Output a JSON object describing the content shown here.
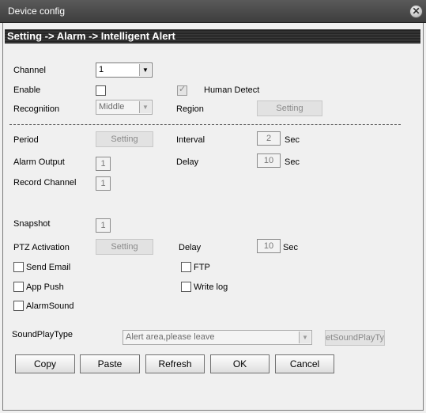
{
  "window": {
    "title": "Device config"
  },
  "breadcrumb": "Setting -> Alarm -> Intelligent Alert",
  "fields": {
    "channel": {
      "label": "Channel",
      "value": "1"
    },
    "enable": {
      "label": "Enable",
      "checked": false
    },
    "human_detect": {
      "label": "Human Detect",
      "checked": true
    },
    "recognition": {
      "label": "Recognition",
      "value": "Middle"
    },
    "region": {
      "label": "Region",
      "button": "Setting"
    },
    "period": {
      "label": "Period",
      "button": "Setting"
    },
    "interval": {
      "label": "Interval",
      "value": "2",
      "unit": "Sec"
    },
    "alarm_output": {
      "label": "Alarm Output",
      "value": "1"
    },
    "delay1": {
      "label": "Delay",
      "value": "10",
      "unit": "Sec"
    },
    "record_channel": {
      "label": "Record Channel",
      "value": "1"
    },
    "snapshot": {
      "label": "Snapshot",
      "value": "1"
    },
    "ptz_activation": {
      "label": "PTZ Activation",
      "button": "Setting"
    },
    "delay2": {
      "label": "Delay",
      "value": "10",
      "unit": "Sec"
    },
    "send_email": {
      "label": "Send Email",
      "checked": false
    },
    "ftp": {
      "label": "FTP",
      "checked": false
    },
    "app_push": {
      "label": "App Push",
      "checked": false
    },
    "write_log": {
      "label": "Write log",
      "checked": false
    },
    "alarm_sound": {
      "label": "AlarmSound",
      "checked": false
    },
    "sound_play_type": {
      "label": "SoundPlayType",
      "value": "Alert area,please leave",
      "button": "etSoundPlayTyp"
    }
  },
  "buttons": {
    "copy": "Copy",
    "paste": "Paste",
    "refresh": "Refresh",
    "ok": "OK",
    "cancel": "Cancel"
  },
  "icons": {
    "close": "close-icon",
    "dropdown": "chevron-down-icon"
  }
}
